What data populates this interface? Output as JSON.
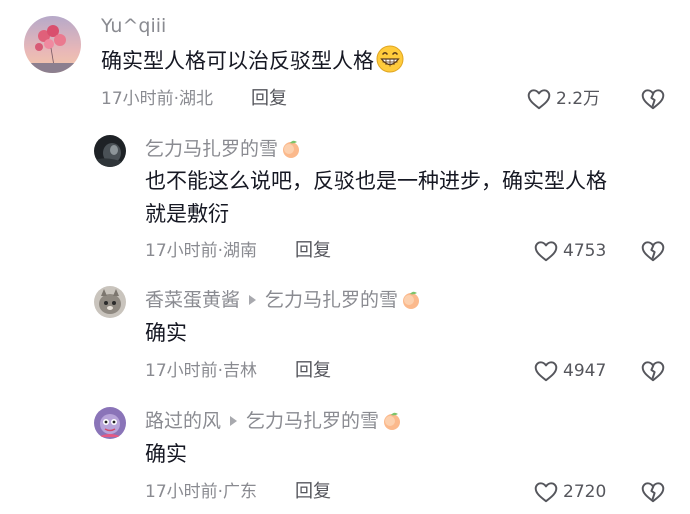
{
  "comments": [
    {
      "username": "Yu^qiii",
      "text_lines": [
        "确实型人格可以治反驳型人格"
      ],
      "emoji": "grin-emoji",
      "time_location": "17小时前·湖北",
      "reply_label": "回复",
      "like_count": "2.2万"
    },
    {
      "username": "乞力马扎罗的雪",
      "text_lines": [
        "也不能这么说吧，反驳也是一种进步，确实型人格",
        "就是敷衍"
      ],
      "time_location": "17小时前·湖南",
      "reply_label": "回复",
      "like_count": "4753"
    },
    {
      "username": "香菜蛋黄酱",
      "reply_to": "乞力马扎罗的雪",
      "text_lines": [
        "确实"
      ],
      "time_location": "17小时前·吉林",
      "reply_label": "回复",
      "like_count": "4947"
    },
    {
      "username": "路过的风",
      "reply_to": "乞力马扎罗的雪",
      "text_lines": [
        "确实"
      ],
      "time_location": "17小时前·广东",
      "reply_label": "回复",
      "like_count": "2720"
    }
  ],
  "colors": {
    "username": "#8a8b91",
    "text": "#161823",
    "meta": "#8a8b91",
    "action": "#55565c"
  },
  "icons": {
    "like": "heart-outline-icon",
    "dislike": "broken-heart-icon",
    "badge": "peach-icon",
    "reply_arrow": "triangle-right-icon"
  }
}
